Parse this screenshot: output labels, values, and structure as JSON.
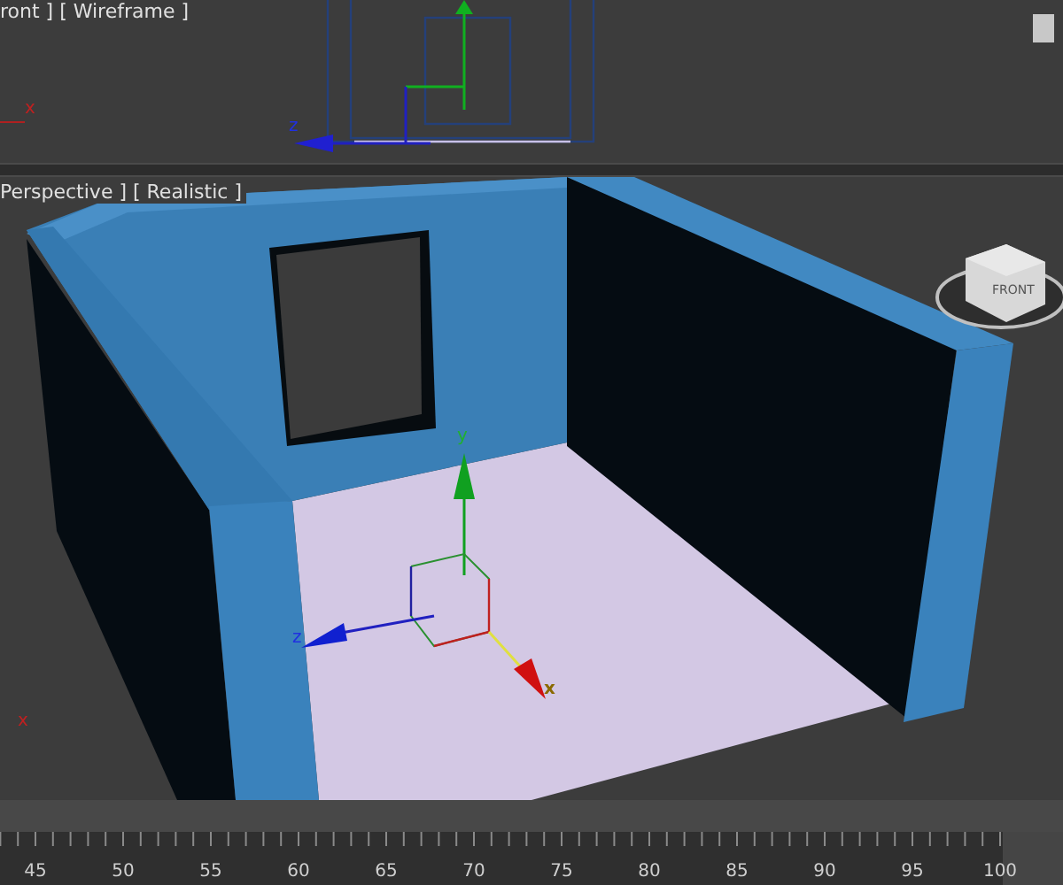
{
  "viewports": [
    {
      "kind": "front",
      "label": "ront ] [ Wireframe ]",
      "axis_labels": [
        "z",
        "x"
      ]
    },
    {
      "kind": "perspective",
      "label": "Perspective ] [ Realistic ]",
      "axis_labels": [
        "y",
        "z",
        "x",
        "x"
      ],
      "viewcube_label": "FRONT"
    }
  ],
  "timeline": {
    "ticks": [
      "45",
      "50",
      "55",
      "60",
      "65",
      "70",
      "75",
      "80",
      "85",
      "90",
      "95",
      "100"
    ]
  }
}
